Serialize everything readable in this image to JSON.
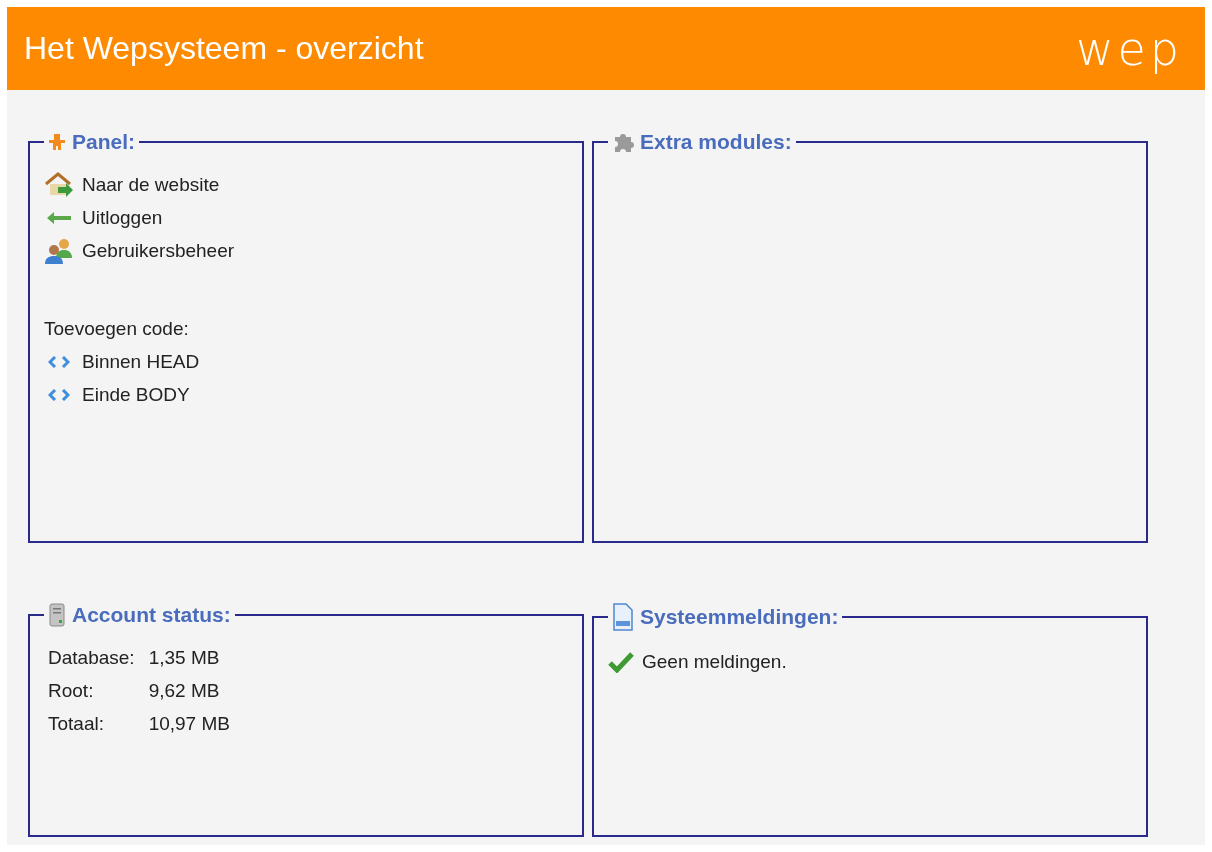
{
  "header": {
    "title": "Het Wepsysteem - overzicht",
    "logo": "wep"
  },
  "panels": [
    {
      "kind": "panel",
      "title": "Panel:",
      "items": [
        {
          "kind": "link",
          "label": "Naar de website"
        },
        {
          "kind": "link",
          "label": "Uitloggen"
        },
        {
          "kind": "link",
          "label": "Gebruikersbeheer"
        },
        {
          "kind": "heading",
          "label": "Toevoegen code:"
        },
        {
          "kind": "link",
          "label": "Binnen HEAD"
        },
        {
          "kind": "link",
          "label": "Einde BODY"
        }
      ]
    },
    {
      "kind": "modules",
      "title": "Extra modules:"
    },
    {
      "kind": "account",
      "title": "Account status:",
      "rows": [
        {
          "label": "Database:",
          "value": "1,35 MB"
        },
        {
          "label": "Root:",
          "value": "9,62 MB"
        },
        {
          "label": "Totaal:",
          "value": "10,97 MB"
        }
      ]
    },
    {
      "kind": "messages",
      "title": "Systeemmeldingen:",
      "items": [
        {
          "label": "Geen meldingen."
        }
      ]
    }
  ]
}
